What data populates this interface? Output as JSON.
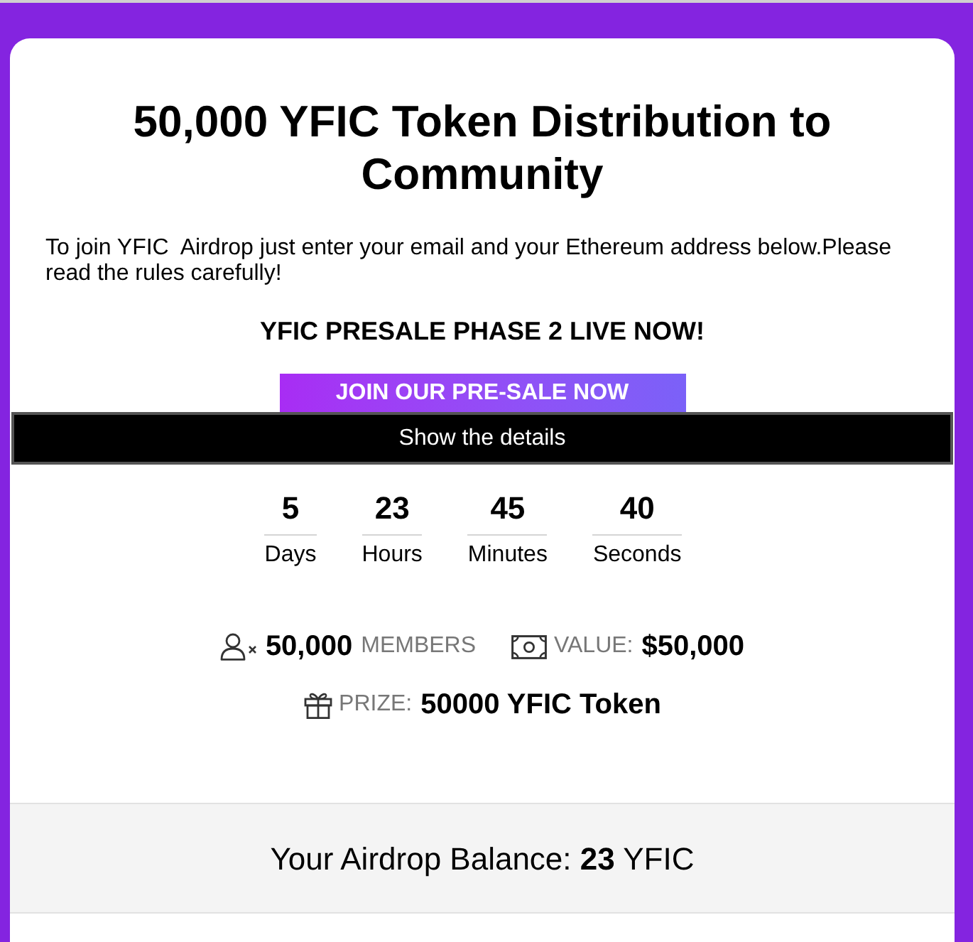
{
  "title": "50,000 YFIC Token Distribution to Community",
  "intro": "To join YFIC  Airdrop just enter your email and your Ethereum address below.Please read the rules carefully!",
  "presale_heading": "YFIC PRESALE PHASE 2 LIVE NOW!",
  "presale_button": {
    "label": "JOIN OUR PRE-SALE NOW"
  },
  "details_bar": {
    "label": "Show the details"
  },
  "countdown": [
    {
      "value": "5",
      "unit": "Days"
    },
    {
      "value": "23",
      "unit": "Hours"
    },
    {
      "value": "45",
      "unit": "Minutes"
    },
    {
      "value": "40",
      "unit": "Seconds"
    }
  ],
  "stats": [
    [
      {
        "kind": "members",
        "value": "50,000",
        "label": "MEMBERS"
      },
      {
        "kind": "value",
        "label": "VALUE:",
        "value": "$50,000"
      }
    ],
    [
      {
        "kind": "prize",
        "label": "PRIZE:",
        "value": "50000 YFIC Token"
      }
    ]
  ],
  "balance": {
    "text": "Your Airdrop Balance: **23** YFIC"
  }
}
